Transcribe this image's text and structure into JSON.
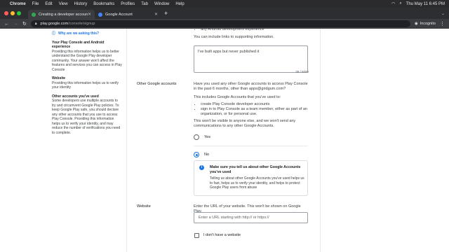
{
  "menubar": {
    "app": "Chrome",
    "items": [
      "File",
      "Edit",
      "View",
      "History",
      "Bookmarks",
      "Profiles",
      "Tab",
      "Window",
      "Help"
    ],
    "clock": "Thu May 11 6:45 PM"
  },
  "tabs": [
    {
      "title": "Creating a developer account"
    },
    {
      "title": "Google Account"
    }
  ],
  "toolbar": {
    "url_host": "play.google.com",
    "url_path": "/console/signup",
    "profile": "Incognito"
  },
  "sidebar": {
    "header": "Why are we asking this?",
    "sections": [
      {
        "title": "Your Play Console and Android experience",
        "body": "Providing this information helps us to better understand the Google Play developer community. Your answer won't affect the features and services you can access in Play Console"
      },
      {
        "title": "Website",
        "body": "Providing this information helps us to verify your identity"
      },
      {
        "title": "Other accounts you've used",
        "body": "Some developers use multiple accounts to try and circumvent Google Play policies. To keep Google Play safe, you should declare any other accounts that you use to access Play Console. Providing this information helps us to verify your identity, and may reduce the number of verifications you need to complete."
      }
    ]
  },
  "experience": {
    "bullet_partial": "",
    "bullet": "any Android development experience",
    "links_note": "You can include links to supporting information.",
    "textarea_value": "I've built apps but never published it",
    "counter": "38 / 5000"
  },
  "other_accounts": {
    "label": "Other Google accounts",
    "question": "Have you used any other Google accounts to access Play Console in the past 6 months, other than apps@gridgum.com?",
    "includes": "This includes Google Accounts that you've used to:",
    "bullets": [
      "create Play Console developer accounts",
      "sign in to Play Console as a team member, either as part of an organization, or for personal use."
    ],
    "privacy": "This won't be visible to anyone else, and we won't send any communications to any other Google Accounts.",
    "yes_label": "Yes",
    "no_label": "No",
    "selected": "No",
    "info_title": "Make sure you tell us about other Google Accounts you've used",
    "info_body": "Telling us about other Google Accounts you've used helps us to fast, helps us to verify your identity, and helps to protect Google Play users from abuse"
  },
  "website": {
    "label": "Website",
    "prompt": "Enter the URL of your website. This won't be shown on Google Play.",
    "placeholder": "Enter a URL starting with http:// or https://",
    "no_website_label": "I don't have a website"
  },
  "colors": {
    "accent": "#1a73e8",
    "chrome_dark": "#2d2e31"
  }
}
